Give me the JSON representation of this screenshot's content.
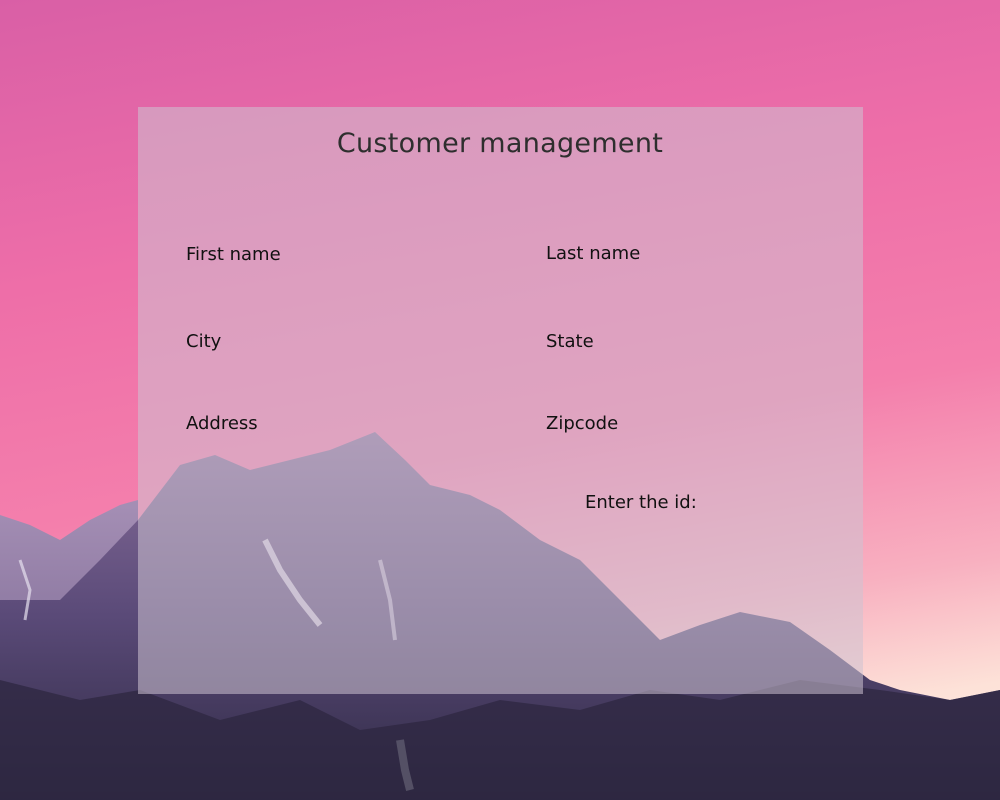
{
  "page": {
    "title": "Customer management"
  },
  "form": {
    "first_name_label": "First name",
    "last_name_label": "Last name",
    "city_label": "City",
    "state_label": "State",
    "address_label": "Address",
    "zipcode_label": "Zipcode",
    "id_prompt": "Enter the id:"
  },
  "colors": {
    "sky_top": "#d95fa6",
    "sky_bottom": "#fde2d8",
    "mountain": "#5a4a78",
    "panel_overlay": "#cdc3d2"
  },
  "background": {
    "image": "mountain-landscape"
  }
}
